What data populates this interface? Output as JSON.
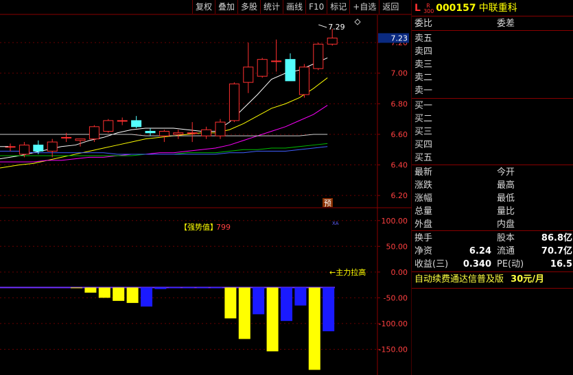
{
  "toolbar": [
    "复权",
    "叠加",
    "多股",
    "统计",
    "画线",
    "F10",
    "标记",
    "+自选",
    "返回"
  ],
  "stock": {
    "marker": "L",
    "badge_top": "R",
    "badge_bottom": "300",
    "code": "000157",
    "name": "中联重科"
  },
  "price_axis": {
    "labels": [
      "7.20",
      "7.00",
      "6.80",
      "6.60",
      "6.40",
      "6.20"
    ],
    "current_price": "7.23",
    "high_annotation": "7.29",
    "ylim": [
      6.12,
      7.38
    ]
  },
  "indicator_axis": {
    "labels": [
      "100.00",
      "50.00",
      "0.00",
      "-50.00",
      "-100.00",
      "-150.00"
    ],
    "ylim": [
      -200,
      125
    ]
  },
  "indicator": {
    "title": "【强势值】",
    "value": "799",
    "note": "←主力拉高",
    "tiny_label": "XA",
    "forecast_badge": "预"
  },
  "chart_data": {
    "type": "candlestick",
    "candles": [
      {
        "o": 6.52,
        "h": 6.54,
        "l": 6.49,
        "c": 6.52
      },
      {
        "o": 6.47,
        "h": 6.55,
        "l": 6.45,
        "c": 6.53
      },
      {
        "o": 6.53,
        "h": 6.56,
        "l": 6.47,
        "c": 6.49
      },
      {
        "o": 6.49,
        "h": 6.57,
        "l": 6.45,
        "c": 6.55
      },
      {
        "o": 6.58,
        "h": 6.61,
        "l": 6.55,
        "c": 6.58
      },
      {
        "o": 6.56,
        "h": 6.57,
        "l": 6.52,
        "c": 6.57
      },
      {
        "o": 6.57,
        "h": 6.66,
        "l": 6.55,
        "c": 6.65
      },
      {
        "o": 6.62,
        "h": 6.7,
        "l": 6.61,
        "c": 6.69
      },
      {
        "o": 6.69,
        "h": 6.71,
        "l": 6.66,
        "c": 6.69
      },
      {
        "o": 6.69,
        "h": 6.72,
        "l": 6.64,
        "c": 6.65
      },
      {
        "o": 6.62,
        "h": 6.64,
        "l": 6.59,
        "c": 6.61
      },
      {
        "o": 6.59,
        "h": 6.63,
        "l": 6.55,
        "c": 6.62
      },
      {
        "o": 6.6,
        "h": 6.63,
        "l": 6.57,
        "c": 6.61
      },
      {
        "o": 6.61,
        "h": 6.68,
        "l": 6.55,
        "c": 6.61
      },
      {
        "o": 6.59,
        "h": 6.65,
        "l": 6.57,
        "c": 6.63
      },
      {
        "o": 6.59,
        "h": 6.7,
        "l": 6.57,
        "c": 6.68
      },
      {
        "o": 6.69,
        "h": 6.94,
        "l": 6.68,
        "c": 6.93
      },
      {
        "o": 6.94,
        "h": 7.2,
        "l": 6.87,
        "c": 7.04
      },
      {
        "o": 6.98,
        "h": 7.1,
        "l": 6.97,
        "c": 7.09
      },
      {
        "o": 7.08,
        "h": 7.22,
        "l": 7.01,
        "c": 7.08
      },
      {
        "o": 7.09,
        "h": 7.13,
        "l": 6.95,
        "c": 6.95
      },
      {
        "o": 6.86,
        "h": 7.06,
        "l": 6.84,
        "c": 7.04
      },
      {
        "o": 7.03,
        "h": 7.2,
        "l": 7.02,
        "c": 7.19
      },
      {
        "o": 7.19,
        "h": 7.29,
        "l": 7.18,
        "c": 7.23
      }
    ],
    "ma": [
      {
        "color": "#ffffff",
        "values": [
          6.44,
          6.46,
          6.48,
          6.5,
          6.52,
          6.53,
          6.56,
          6.58,
          6.61,
          6.63,
          6.64,
          6.64,
          6.64,
          6.63,
          6.62,
          6.62,
          6.68,
          6.77,
          6.86,
          6.96,
          7.0,
          7.02,
          7.06,
          7.1
        ]
      },
      {
        "color": "#ffff00",
        "values": [
          6.38,
          6.4,
          6.41,
          6.43,
          6.45,
          6.47,
          6.49,
          6.51,
          6.53,
          6.55,
          6.57,
          6.58,
          6.59,
          6.6,
          6.61,
          6.61,
          6.63,
          6.67,
          6.72,
          6.77,
          6.8,
          6.84,
          6.9,
          6.97
        ]
      },
      {
        "color": "#ff00ff",
        "values": [
          6.42,
          6.42,
          6.42,
          6.43,
          6.43,
          6.44,
          6.45,
          6.45,
          6.46,
          6.47,
          6.47,
          6.48,
          6.48,
          6.49,
          6.5,
          6.51,
          6.53,
          6.56,
          6.59,
          6.62,
          6.65,
          6.69,
          6.73,
          6.79
        ]
      },
      {
        "color": "#00c000",
        "values": [
          6.46,
          6.46,
          6.46,
          6.46,
          6.46,
          6.46,
          6.46,
          6.46,
          6.46,
          6.46,
          6.47,
          6.47,
          6.47,
          6.48,
          6.48,
          6.48,
          6.49,
          6.5,
          6.5,
          6.51,
          6.51,
          6.52,
          6.53,
          6.54
        ]
      },
      {
        "color": "#4060ff",
        "values": [
          6.49,
          6.49,
          6.48,
          6.48,
          6.48,
          6.48,
          6.48,
          6.48,
          6.47,
          6.47,
          6.47,
          6.47,
          6.47,
          6.47,
          6.47,
          6.47,
          6.48,
          6.48,
          6.49,
          6.49,
          6.49,
          6.5,
          6.51,
          6.52
        ]
      },
      {
        "color": "#d0d0d0",
        "values": [
          6.6,
          6.6,
          6.6,
          6.6,
          6.6,
          6.6,
          6.6,
          6.6,
          6.6,
          6.6,
          6.59,
          6.59,
          6.59,
          6.59,
          6.59,
          6.59,
          6.59,
          6.59,
          6.59,
          6.59,
          6.59,
          6.59,
          6.6,
          6.6
        ]
      }
    ],
    "bars": [
      0,
      0,
      0,
      0,
      0,
      -28,
      -40,
      -50,
      -56,
      -60,
      -67,
      -33,
      -20,
      -10,
      -6,
      -4,
      -90,
      -130,
      -82,
      -154,
      -95,
      -65,
      -190,
      -115
    ],
    "baseline": -30
  },
  "panel": {
    "row1": {
      "a": "委比",
      "b": "委差"
    },
    "sell": [
      "卖五",
      "卖四",
      "卖三",
      "卖二",
      "卖一"
    ],
    "buy": [
      "买一",
      "买二",
      "买三",
      "买四",
      "买五"
    ],
    "stats": [
      {
        "a": "最新",
        "b": "今开"
      },
      {
        "a": "涨跌",
        "b": "最高"
      },
      {
        "a": "涨幅",
        "b": "最低"
      },
      {
        "a": "总量",
        "b": "量比"
      },
      {
        "a": "外盘",
        "b": "内盘"
      }
    ],
    "fin": [
      {
        "a": "换手",
        "av": "",
        "b": "股本",
        "bv": "86.8亿"
      },
      {
        "a": "净资",
        "av": "6.24",
        "b": "流通",
        "bv": "70.7亿"
      },
      {
        "a": "收益(三)",
        "av": "0.340",
        "b": "PE(动)",
        "bv": "16.5"
      }
    ],
    "ad_text": "自动续费通达信普及版",
    "ad_price": "30元/月"
  }
}
